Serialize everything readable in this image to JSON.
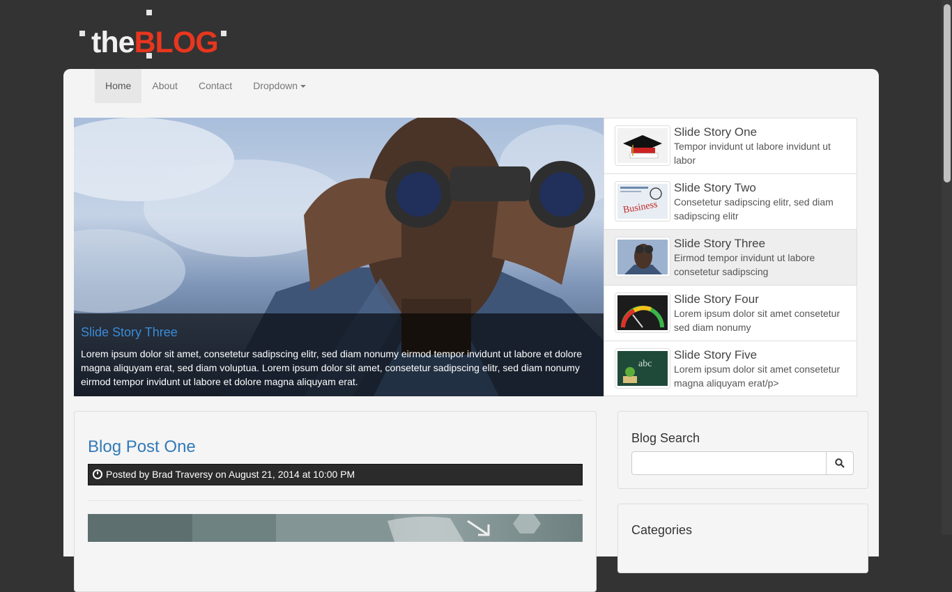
{
  "brand": {
    "part1": "the",
    "part2": "BLOG"
  },
  "nav": {
    "items": [
      {
        "label": "Home"
      },
      {
        "label": "About"
      },
      {
        "label": "Contact"
      },
      {
        "label": "Dropdown"
      }
    ]
  },
  "slider": {
    "caption_title": "Slide Story Three",
    "caption_text": "Lorem ipsum dolor sit amet, consetetur sadipscing elitr, sed diam nonumy eirmod tempor invidunt ut labore et dolore magna aliquyam erat, sed diam voluptua. Lorem ipsum dolor sit amet, consetetur sadipscing elitr, sed diam nonumy eirmod tempor invidunt ut labore et dolore magna aliquyam erat."
  },
  "stories": [
    {
      "title": "Slide Story One",
      "desc": "Tempor invidunt ut labore invidunt ut labor"
    },
    {
      "title": "Slide Story Two",
      "desc": "Consetetur sadipscing elitr, sed diam sadipscing elitr"
    },
    {
      "title": "Slide Story Three",
      "desc": "Eirmod tempor invidunt ut labore consetetur sadipscing"
    },
    {
      "title": "Slide Story Four",
      "desc": "Lorem ipsum dolor sit amet consetetur sed diam nonumy"
    },
    {
      "title": "Slide Story Five",
      "desc": "Lorem ipsum dolor sit amet consetetur magna aliquyam erat/p>"
    }
  ],
  "post": {
    "title": "Blog Post One",
    "meta": "Posted by Brad Traversy on August 21, 2014 at 10:00 PM"
  },
  "sidebar": {
    "search_title": "Blog Search",
    "search_value": "",
    "categories_title": "Categories"
  },
  "thumb_labels": {
    "two": "Business",
    "five": "abc"
  },
  "colors": {
    "background": "#333333",
    "accent": "#337ab7",
    "brand_red": "#e8361e"
  }
}
